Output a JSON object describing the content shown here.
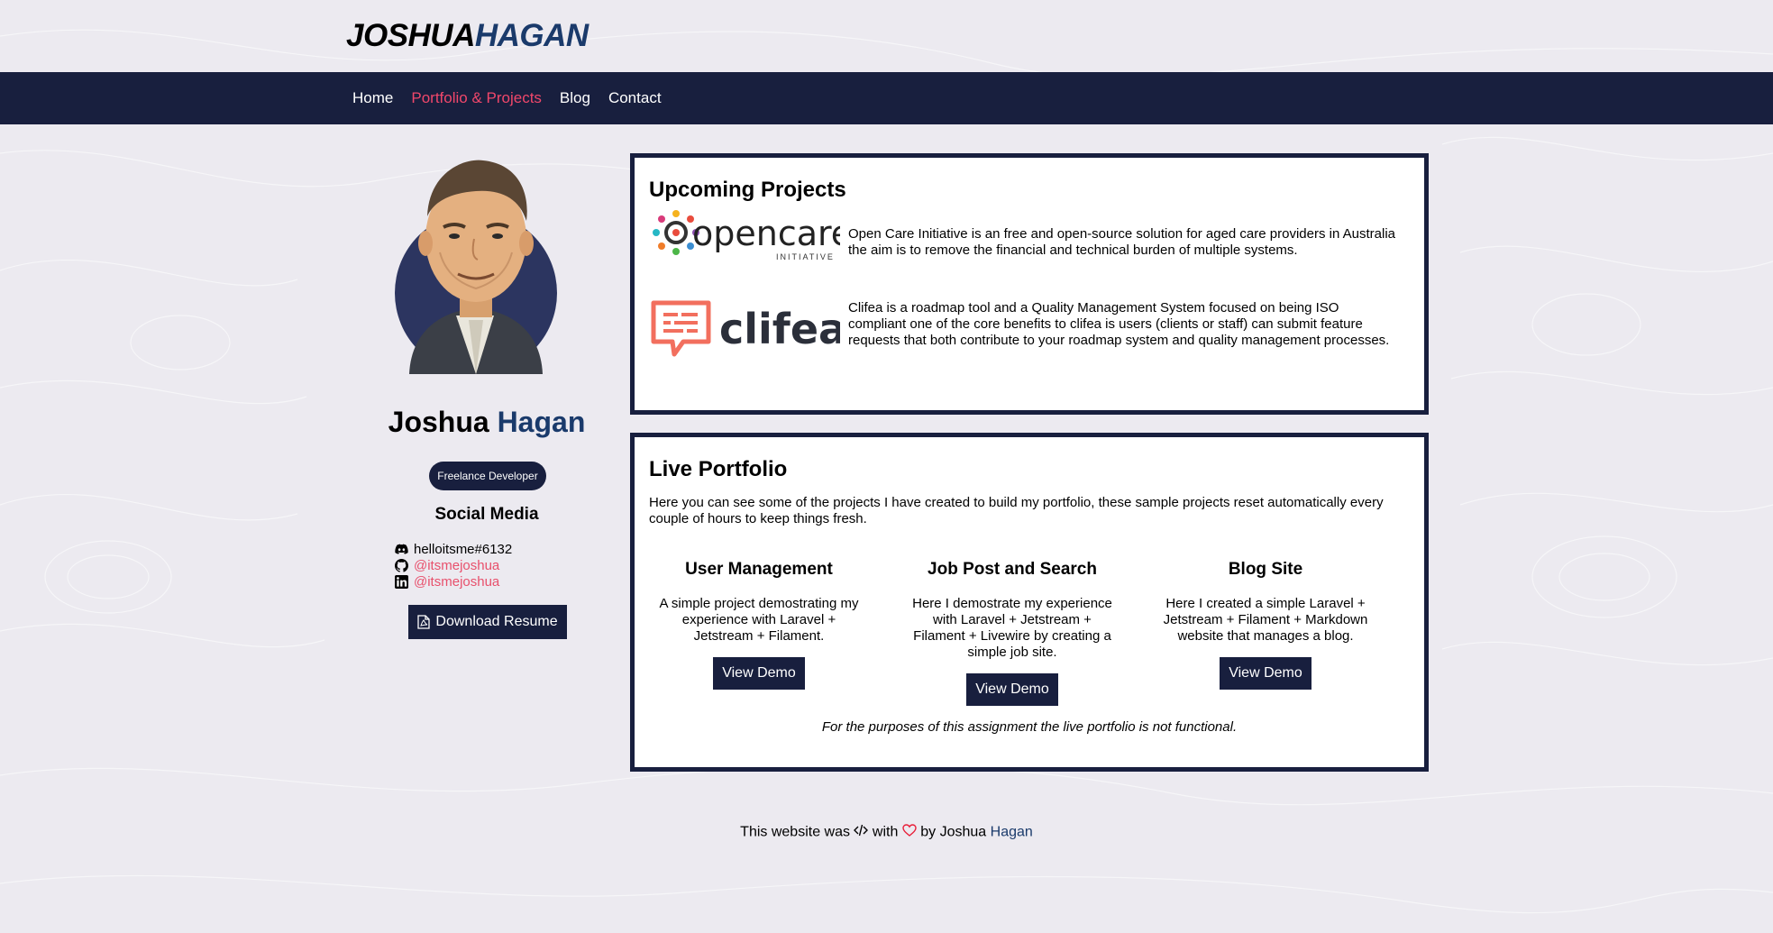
{
  "brand": {
    "first": "JOSHUA",
    "last": "HAGAN"
  },
  "nav": {
    "items": [
      {
        "label": "Home"
      },
      {
        "label": "Portfolio & Projects",
        "active": true
      },
      {
        "label": "Blog"
      },
      {
        "label": "Contact"
      }
    ]
  },
  "profile": {
    "first_name": "Joshua",
    "last_name": "Hagan",
    "role": "Freelance Developer",
    "social_title": "Social Media",
    "social": [
      {
        "icon": "discord-icon",
        "text": "helloitsme#6132",
        "link": false
      },
      {
        "icon": "github-icon",
        "text": "@itsmejoshua",
        "link": true
      },
      {
        "icon": "linkedin-icon",
        "text": "@itsmejoshua",
        "link": true
      }
    ],
    "resume_label": "Download Resume"
  },
  "upcoming": {
    "title": "Upcoming Projects",
    "projects": [
      {
        "logo_word": "opencare",
        "logo_sub": "INITIATIVE",
        "description": "Open Care Initiative is an free and open-source solution for aged care providers in Australia the aim is to remove the financial and technical burden of multiple systems."
      },
      {
        "logo_word": "clifea",
        "description": "Clifea is a roadmap tool and a Quality Management System focused on being ISO compliant one of the core benefits to clifea is users (clients or staff) can submit feature requests that both contribute to your roadmap system and quality management processes."
      }
    ]
  },
  "portfolio": {
    "title": "Live Portfolio",
    "intro": "Here you can see some of the projects I have created to build my portfolio, these sample projects reset automatically every couple of hours to keep things fresh.",
    "demos": [
      {
        "title": "User Management",
        "description": "A simple project demostrating my experience with Laravel + Jetstream + Filament.",
        "button": "View Demo"
      },
      {
        "title": "Job Post and Search",
        "description": "Here I demostrate my experience with Laravel + Jetstream + Filament + Livewire by creating a simple job site.",
        "button": "View Demo"
      },
      {
        "title": "Blog Site",
        "description": "Here I created a simple Laravel + Jetstream + Filament + Markdown website that manages a blog.",
        "button": "View Demo"
      }
    ],
    "note": "For the purposes of this assignment the live portfolio is not functional."
  },
  "footer": {
    "prefix": "This website was",
    "with": "with",
    "by": "by Joshua",
    "name": "Hagan"
  },
  "colors": {
    "navy": "#181f3e",
    "accent_pink": "#f0476b",
    "brand_blue": "#1a3a6b",
    "background": "#eceaf0"
  }
}
